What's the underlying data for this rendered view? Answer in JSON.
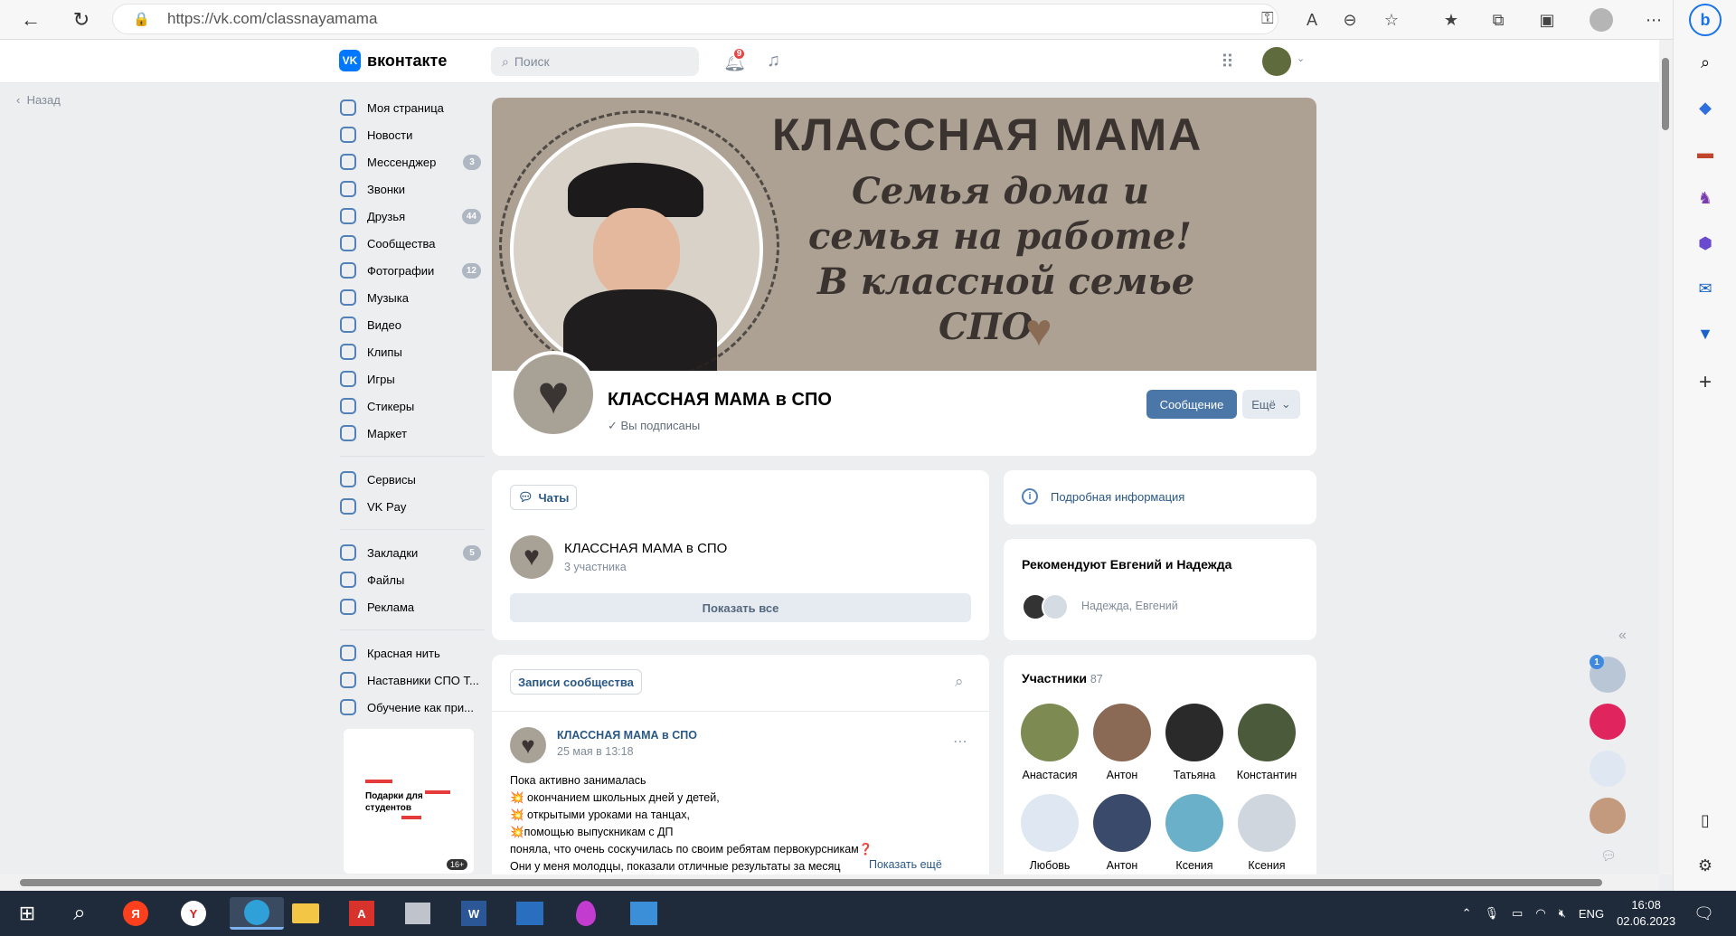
{
  "browser": {
    "url": "https://vk.com/classnayamama"
  },
  "vk": {
    "logo_text": "вконтакте",
    "search_placeholder": "Поиск",
    "notif_count": "9",
    "back": "Назад"
  },
  "menu": {
    "group1": [
      {
        "label": "Моя страница",
        "count": ""
      },
      {
        "label": "Новости",
        "count": ""
      },
      {
        "label": "Мессенджер",
        "count": "3"
      },
      {
        "label": "Звонки",
        "count": ""
      },
      {
        "label": "Друзья",
        "count": "44"
      },
      {
        "label": "Сообщества",
        "count": ""
      },
      {
        "label": "Фотографии",
        "count": "12"
      },
      {
        "label": "Музыка",
        "count": ""
      },
      {
        "label": "Видео",
        "count": ""
      },
      {
        "label": "Клипы",
        "count": ""
      },
      {
        "label": "Игры",
        "count": ""
      },
      {
        "label": "Стикеры",
        "count": ""
      },
      {
        "label": "Маркет",
        "count": ""
      }
    ],
    "group2": [
      {
        "label": "Сервисы",
        "count": ""
      },
      {
        "label": "VK Pay",
        "count": ""
      }
    ],
    "group3": [
      {
        "label": "Закладки",
        "count": "5"
      },
      {
        "label": "Файлы",
        "count": ""
      },
      {
        "label": "Реклама",
        "count": ""
      }
    ],
    "group4": [
      {
        "label": "Красная нить",
        "count": ""
      },
      {
        "label": "Наставники СПО Т...",
        "count": ""
      },
      {
        "label": "Обучение как при...",
        "count": ""
      }
    ],
    "ad_text": "Подарки для студентов",
    "ad_badge": "16+"
  },
  "cover": {
    "title": "КЛАССНАЯ МАМА",
    "line1": "Семья дома и",
    "line2": "семья на работе!",
    "line3": "В классной семье",
    "line4": "СПО"
  },
  "profile": {
    "name": "КЛАССНАЯ МАМА в СПО",
    "subscribed": "Вы подписаны",
    "message_btn": "Сообщение",
    "more_btn": "Ещё"
  },
  "chats": {
    "tab": "Чаты",
    "chat_name": "КЛАССНАЯ МАМА в СПО",
    "chat_members": "3 участника",
    "show_all": "Показать все"
  },
  "info": {
    "label": "Подробная информация"
  },
  "recommend": {
    "title": "Рекомендуют Евгений и Надежда",
    "names": "Надежда, Евгений"
  },
  "posts": {
    "tab": "Записи сообщества",
    "author": "КЛАССНАЯ МАМА в СПО",
    "date": "25 мая в 13:18",
    "lines": [
      "Пока активно занималась",
      "💥 окончанием школьных дней у детей,",
      "💥 открытыми уроками на танцах,",
      "💥помощью выпускникам с ДП",
      "поняла, что очень соскучилась по своим ребятам первокурсникам❓",
      "Они у меня молодцы, показали отличные результаты за месяц"
    ],
    "show_more": "Показать ещё"
  },
  "members": {
    "title": "Участники",
    "count": "87",
    "list": [
      {
        "name": "Анастасия",
        "color": "#7d8a52"
      },
      {
        "name": "Антон",
        "color": "#8a6a55"
      },
      {
        "name": "Татьяна",
        "color": "#2a2a2a"
      },
      {
        "name": "Константин",
        "color": "#4a5a3a"
      },
      {
        "name": "Любовь",
        "color": "#dfe8f2"
      },
      {
        "name": "Антон",
        "color": "#3a4a6a"
      },
      {
        "name": "Ксения",
        "color": "#6bb0c9"
      },
      {
        "name": "Ксения",
        "color": "#d0d6de"
      }
    ]
  },
  "float": {
    "badge": "1"
  },
  "taskbar": {
    "lang": "ENG",
    "time": "16:08",
    "date": "02.06.2023"
  }
}
